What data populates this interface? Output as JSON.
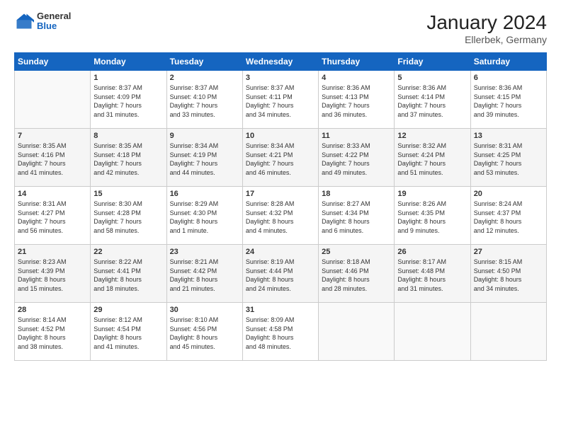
{
  "header": {
    "logo_general": "General",
    "logo_blue": "Blue",
    "month_title": "January 2024",
    "location": "Ellerbek, Germany"
  },
  "days_of_week": [
    "Sunday",
    "Monday",
    "Tuesday",
    "Wednesday",
    "Thursday",
    "Friday",
    "Saturday"
  ],
  "weeks": [
    [
      {
        "day": "",
        "content": ""
      },
      {
        "day": "1",
        "content": "Sunrise: 8:37 AM\nSunset: 4:09 PM\nDaylight: 7 hours\nand 31 minutes."
      },
      {
        "day": "2",
        "content": "Sunrise: 8:37 AM\nSunset: 4:10 PM\nDaylight: 7 hours\nand 33 minutes."
      },
      {
        "day": "3",
        "content": "Sunrise: 8:37 AM\nSunset: 4:11 PM\nDaylight: 7 hours\nand 34 minutes."
      },
      {
        "day": "4",
        "content": "Sunrise: 8:36 AM\nSunset: 4:13 PM\nDaylight: 7 hours\nand 36 minutes."
      },
      {
        "day": "5",
        "content": "Sunrise: 8:36 AM\nSunset: 4:14 PM\nDaylight: 7 hours\nand 37 minutes."
      },
      {
        "day": "6",
        "content": "Sunrise: 8:36 AM\nSunset: 4:15 PM\nDaylight: 7 hours\nand 39 minutes."
      }
    ],
    [
      {
        "day": "7",
        "content": "Sunrise: 8:35 AM\nSunset: 4:16 PM\nDaylight: 7 hours\nand 41 minutes."
      },
      {
        "day": "8",
        "content": "Sunrise: 8:35 AM\nSunset: 4:18 PM\nDaylight: 7 hours\nand 42 minutes."
      },
      {
        "day": "9",
        "content": "Sunrise: 8:34 AM\nSunset: 4:19 PM\nDaylight: 7 hours\nand 44 minutes."
      },
      {
        "day": "10",
        "content": "Sunrise: 8:34 AM\nSunset: 4:21 PM\nDaylight: 7 hours\nand 46 minutes."
      },
      {
        "day": "11",
        "content": "Sunrise: 8:33 AM\nSunset: 4:22 PM\nDaylight: 7 hours\nand 49 minutes."
      },
      {
        "day": "12",
        "content": "Sunrise: 8:32 AM\nSunset: 4:24 PM\nDaylight: 7 hours\nand 51 minutes."
      },
      {
        "day": "13",
        "content": "Sunrise: 8:31 AM\nSunset: 4:25 PM\nDaylight: 7 hours\nand 53 minutes."
      }
    ],
    [
      {
        "day": "14",
        "content": "Sunrise: 8:31 AM\nSunset: 4:27 PM\nDaylight: 7 hours\nand 56 minutes."
      },
      {
        "day": "15",
        "content": "Sunrise: 8:30 AM\nSunset: 4:28 PM\nDaylight: 7 hours\nand 58 minutes."
      },
      {
        "day": "16",
        "content": "Sunrise: 8:29 AM\nSunset: 4:30 PM\nDaylight: 8 hours\nand 1 minute."
      },
      {
        "day": "17",
        "content": "Sunrise: 8:28 AM\nSunset: 4:32 PM\nDaylight: 8 hours\nand 4 minutes."
      },
      {
        "day": "18",
        "content": "Sunrise: 8:27 AM\nSunset: 4:34 PM\nDaylight: 8 hours\nand 6 minutes."
      },
      {
        "day": "19",
        "content": "Sunrise: 8:26 AM\nSunset: 4:35 PM\nDaylight: 8 hours\nand 9 minutes."
      },
      {
        "day": "20",
        "content": "Sunrise: 8:24 AM\nSunset: 4:37 PM\nDaylight: 8 hours\nand 12 minutes."
      }
    ],
    [
      {
        "day": "21",
        "content": "Sunrise: 8:23 AM\nSunset: 4:39 PM\nDaylight: 8 hours\nand 15 minutes."
      },
      {
        "day": "22",
        "content": "Sunrise: 8:22 AM\nSunset: 4:41 PM\nDaylight: 8 hours\nand 18 minutes."
      },
      {
        "day": "23",
        "content": "Sunrise: 8:21 AM\nSunset: 4:42 PM\nDaylight: 8 hours\nand 21 minutes."
      },
      {
        "day": "24",
        "content": "Sunrise: 8:19 AM\nSunset: 4:44 PM\nDaylight: 8 hours\nand 24 minutes."
      },
      {
        "day": "25",
        "content": "Sunrise: 8:18 AM\nSunset: 4:46 PM\nDaylight: 8 hours\nand 28 minutes."
      },
      {
        "day": "26",
        "content": "Sunrise: 8:17 AM\nSunset: 4:48 PM\nDaylight: 8 hours\nand 31 minutes."
      },
      {
        "day": "27",
        "content": "Sunrise: 8:15 AM\nSunset: 4:50 PM\nDaylight: 8 hours\nand 34 minutes."
      }
    ],
    [
      {
        "day": "28",
        "content": "Sunrise: 8:14 AM\nSunset: 4:52 PM\nDaylight: 8 hours\nand 38 minutes."
      },
      {
        "day": "29",
        "content": "Sunrise: 8:12 AM\nSunset: 4:54 PM\nDaylight: 8 hours\nand 41 minutes."
      },
      {
        "day": "30",
        "content": "Sunrise: 8:10 AM\nSunset: 4:56 PM\nDaylight: 8 hours\nand 45 minutes."
      },
      {
        "day": "31",
        "content": "Sunrise: 8:09 AM\nSunset: 4:58 PM\nDaylight: 8 hours\nand 48 minutes."
      },
      {
        "day": "",
        "content": ""
      },
      {
        "day": "",
        "content": ""
      },
      {
        "day": "",
        "content": ""
      }
    ]
  ]
}
